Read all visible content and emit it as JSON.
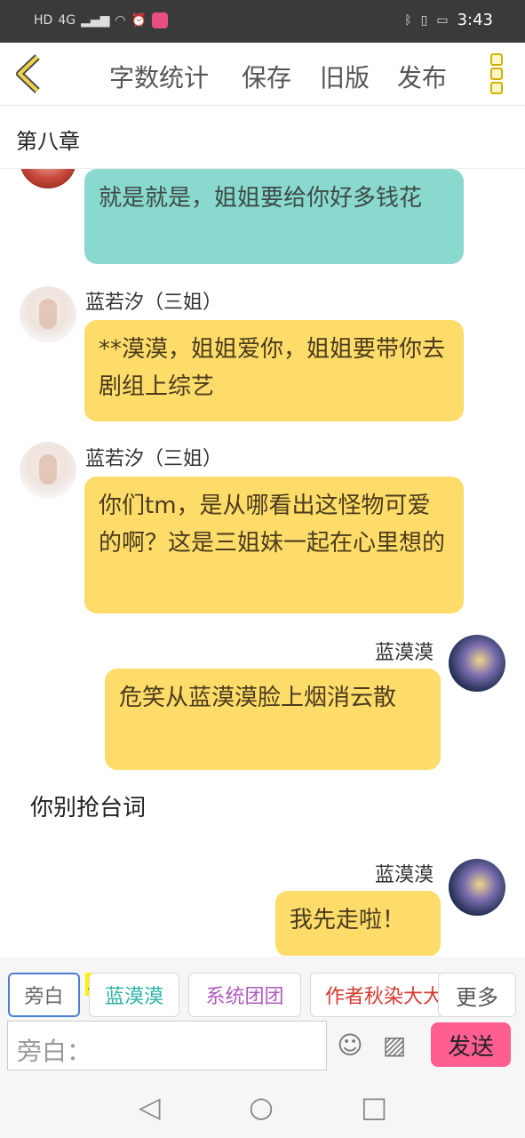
{
  "status_bar": {
    "network_labels": [
      "HD",
      "4G"
    ],
    "time": "3:43",
    "icons": [
      "signal-icon",
      "wifi-icon",
      "alarm-icon",
      "app-icon",
      "bluetooth-icon",
      "vibrate-icon",
      "battery-icon"
    ]
  },
  "toolbar": {
    "back_icon": "back-chevron-icon",
    "items": [
      "字数统计",
      "保存",
      "旧版",
      "发布"
    ],
    "more_icon": "more-dots-icon",
    "accent": "#d4b200"
  },
  "chapter": {
    "title": "第八章"
  },
  "messages": [
    {
      "speaker": "",
      "text": "就是就是，姐姐要给你好多钱花",
      "side": "left",
      "color": "#8ad9cf"
    },
    {
      "speaker": "蓝若汐（三姐）",
      "text": "**漠漠，姐姐爱你，姐姐要带你去剧组上综艺",
      "side": "left",
      "color": "#fddc6a"
    },
    {
      "speaker": "蓝若汐（三姐）",
      "text": "你们tm，是从哪看出这怪物可爱的啊？这是三姐妹一起在心里想的",
      "side": "left",
      "color": "#fddc6a"
    },
    {
      "speaker": "蓝漠漠",
      "text": "危笑从蓝漠漠脸上烟消云散",
      "side": "right",
      "color": "#fddc6a"
    },
    {
      "speaker": "",
      "text": "你别抢台词",
      "side": "narration"
    },
    {
      "speaker": "蓝漠漠",
      "text": "我先走啦！",
      "side": "right",
      "color": "#fddc6a"
    }
  ],
  "roles": {
    "main_badge": "主",
    "items": [
      {
        "label": "旁白",
        "color": "#666666"
      },
      {
        "label": "蓝漠漠",
        "color": "#2bb3a6"
      },
      {
        "label": "系统团团",
        "color": "#b05ac0"
      },
      {
        "label": "作者秋染大大",
        "color": "#d53b2f"
      }
    ],
    "more": "更多"
  },
  "input": {
    "placeholder": "旁白：",
    "emoji_icon": "emoji-icon",
    "image_icon": "image-icon",
    "send": "发送",
    "send_color": "#ff5e91"
  },
  "nav": {
    "icons": [
      "back-triangle-icon",
      "home-circle-icon",
      "recents-square-icon"
    ]
  }
}
